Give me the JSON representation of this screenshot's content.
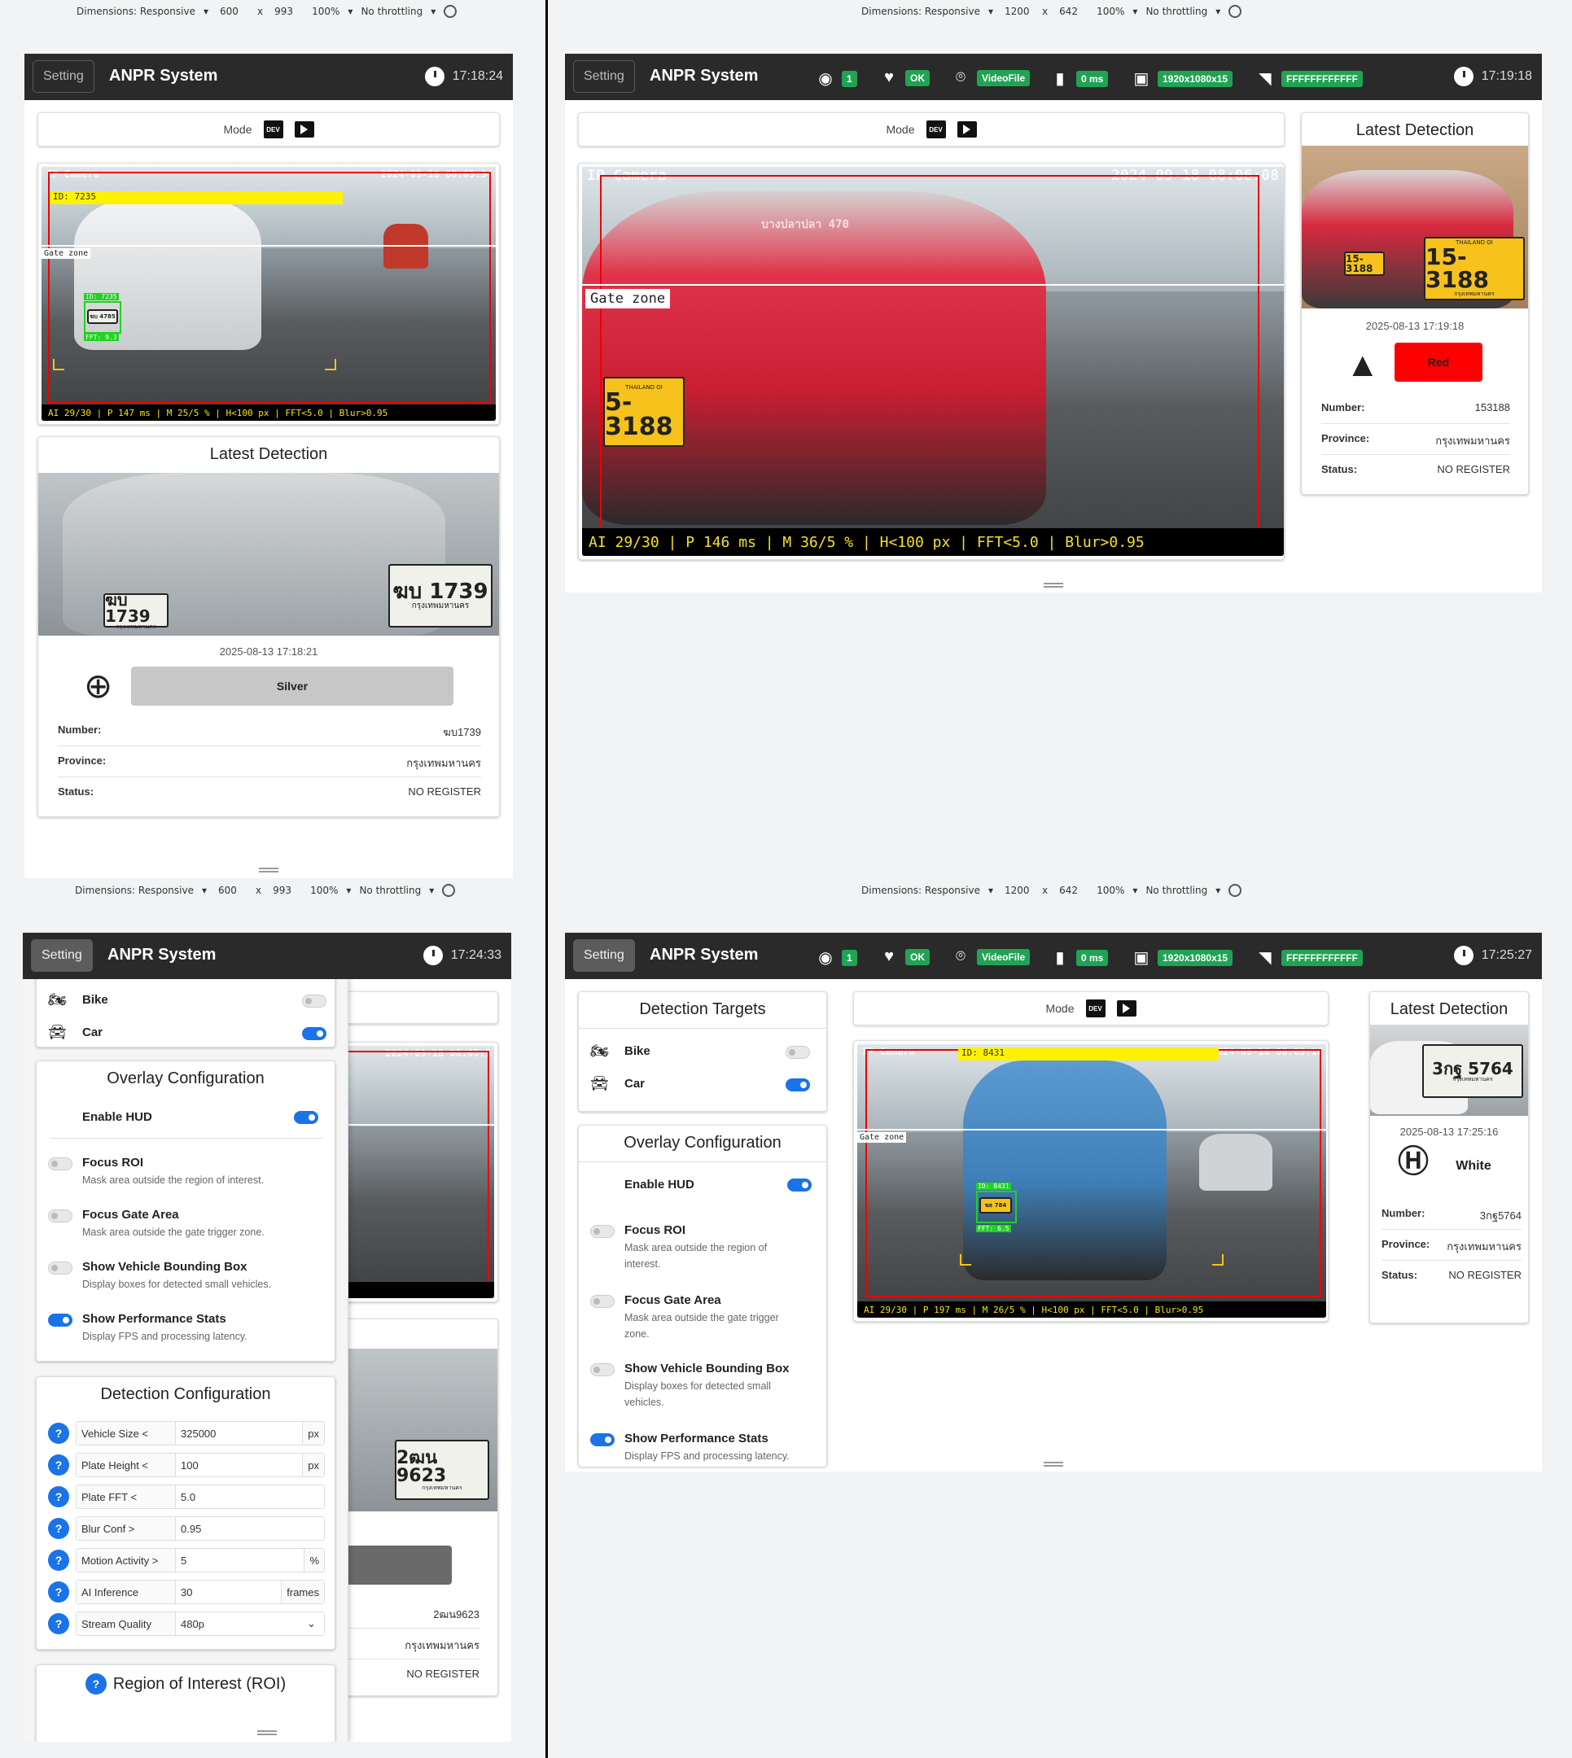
{
  "devtools": [
    {
      "dimensions_label": "Dimensions: Responsive",
      "width": "600",
      "x": "x",
      "height": "993",
      "zoom": "100%",
      "throttle": "No throttling"
    },
    {
      "dimensions_label": "Dimensions: Responsive",
      "width": "1200",
      "x": "x",
      "height": "642",
      "zoom": "100%",
      "throttle": "No throttling"
    },
    {
      "dimensions_label": "Dimensions: Responsive",
      "width": "600",
      "x": "x",
      "height": "993",
      "zoom": "100%",
      "throttle": "No throttling"
    },
    {
      "dimensions_label": "Dimensions: Responsive",
      "width": "1200",
      "x": "x",
      "height": "642",
      "zoom": "100%",
      "throttle": "No throttling"
    }
  ],
  "app": {
    "title": "ANPR System",
    "setting_label": "Setting",
    "mode_label": "Mode",
    "dev_label": "DEV"
  },
  "status": {
    "viewers": "1",
    "health": "OK",
    "source": "VideoFile",
    "latency": "0 ms",
    "resolution": "1920x1080x15",
    "camera_id": "FFFFFFFFFFFF"
  },
  "panels": {
    "tl": {
      "time": "17:18:24",
      "cam": {
        "label": "IP Camera",
        "timestamp": "2024-09-18 08:05:34",
        "id_tag": "ID: 7235",
        "gate": "Gate zone",
        "hud": "AI 29/30 | P 147 ms | M 25/5 % | H<100 px | FFT<5.0 | Blur>0.95",
        "box_id": "ID: 7235",
        "box_fft": "FFT: 9.3",
        "small_plate": "ฆบ 4785"
      },
      "latest": {
        "title": "Latest Detection",
        "plate_big": "ฆบ 1739",
        "plate_big_prov": "กรุงเทพมหานคร",
        "plate_small": "ฆบ 1739",
        "plate_small_prov": "กรุงเทพมหานคร",
        "datetime": "2025-08-13 17:18:21",
        "brand": "Toyota",
        "brand_icon": "toyota-logo",
        "color": "Silver",
        "number_label": "Number:",
        "number": "ฆบ1739",
        "province_label": "Province:",
        "province": "กรุงเทพมหานคร",
        "status_label": "Status:",
        "status": "NO REGISTER"
      }
    },
    "tr": {
      "time": "17:19:18",
      "cam": {
        "label": "IP Camera",
        "timestamp": "2024-09-18 08:06:08",
        "gate": "Gate zone",
        "hud": "AI 29/30 | P 146 ms | M 36/5 % | H<100 px | FFT<5.0 | Blur>0.95",
        "plate": "5-3188",
        "plate_top": "THAILAND OI",
        "truck_text": "บางปลาปลา 470"
      },
      "latest": {
        "title": "Latest Detection",
        "plate": "15-3188",
        "plate_top": "THAILAND OI",
        "plate_bottom": "กรุงเทพมหานคร",
        "plate_small": "15-3188",
        "datetime": "2025-08-13 17:19:18",
        "brand": "Mitsubishi",
        "brand_icon": "mitsubishi-logo",
        "color": "Red",
        "number_label": "Number:",
        "number": "153188",
        "province_label": "Province:",
        "province": "กรุงเทพมหานคร",
        "status_label": "Status:",
        "status": "NO REGISTER"
      }
    },
    "bl": {
      "time": "17:24:33",
      "targets": [
        {
          "label": "Bike",
          "icon": "motorcycle-icon",
          "on": false
        },
        {
          "label": "Car",
          "icon": "car-icon",
          "on": true
        }
      ],
      "overlay_title": "Overlay Configuration",
      "enable_hud": "Enable HUD",
      "options": [
        {
          "title": "Focus ROI",
          "desc": "Mask area outside the region of interest.",
          "on": false
        },
        {
          "title": "Focus Gate Area",
          "desc": "Mask area outside the gate trigger zone.",
          "on": false
        },
        {
          "title": "Show Vehicle Bounding Box",
          "desc": "Display boxes for detected small vehicles.",
          "on": false
        },
        {
          "title": "Show Performance Stats",
          "desc": "Display FPS and processing latency.",
          "on": true
        }
      ],
      "detection_title": "Detection Configuration",
      "fields": [
        {
          "label": "Vehicle Size <",
          "value": "325000",
          "unit": "px"
        },
        {
          "label": "Plate Height <",
          "value": "100",
          "unit": "px"
        },
        {
          "label": "Plate FFT <",
          "value": "5.0",
          "unit": ""
        },
        {
          "label": "Blur Conf >",
          "value": "0.95",
          "unit": ""
        },
        {
          "label": "Motion Activity >",
          "value": "5",
          "unit": "%"
        },
        {
          "label": "AI Inference",
          "value": "30",
          "unit": "frames"
        },
        {
          "label": "Stream Quality",
          "value": "480p",
          "unit": ""
        }
      ],
      "roi_title": "Region of Interest (ROI)",
      "behind": {
        "timestamp": "2024-09-18 08:05:5",
        "plate": "2ฒน 9623",
        "plate_prov": "กรุงเทพมหานคร",
        "number": "2ฒน9623",
        "province": "กรุงเทพมหานคร",
        "status": "NO REGISTER"
      }
    },
    "br": {
      "time": "17:25:27",
      "targets_title": "Detection Targets",
      "targets": [
        {
          "label": "Bike",
          "icon": "motorcycle-icon",
          "on": false
        },
        {
          "label": "Car",
          "icon": "car-icon",
          "on": true
        }
      ],
      "overlay_title": "Overlay Configuration",
      "enable_hud": "Enable HUD",
      "options": [
        {
          "title": "Focus ROI",
          "desc1": "Mask area outside the region of",
          "desc2": "interest.",
          "on": false
        },
        {
          "title": "Focus Gate Area",
          "desc1": "Mask area outside the gate trigger",
          "desc2": "zone.",
          "on": false
        },
        {
          "title": "Show Vehicle Bounding Box",
          "desc1": "Display boxes for detected small",
          "desc2": "vehicles.",
          "on": false
        },
        {
          "title": "Show Performance Stats",
          "desc1": "Display FPS and processing latency.",
          "desc2": "",
          "on": true
        }
      ],
      "cam": {
        "label": "IP Camera",
        "timestamp": "2024-09-18 08:05:16",
        "id_tag": "ID: 8431",
        "gate": "Gate zone",
        "hud": "AI 29/30 | P 197 ms | M 26/5 % | H<100 px | FFT<5.0 | Blur>0.95",
        "box_id": "ID: 8431",
        "box_fft": "FFT: 6.5",
        "small_plate": "ฆธ 784"
      },
      "latest": {
        "title": "Latest Detection",
        "plate": "3กฐ 5764",
        "plate_bottom": "กรุงเทพมหานคร",
        "datetime": "2025-08-13 17:25:16",
        "brand": "Honda",
        "brand_icon": "honda-logo",
        "color": "White",
        "number_label": "Number:",
        "number": "3กฐ5764",
        "province_label": "Province:",
        "province": "กรุงเทพมหานคร",
        "status_label": "Status:",
        "status": "NO REGISTER"
      }
    }
  }
}
